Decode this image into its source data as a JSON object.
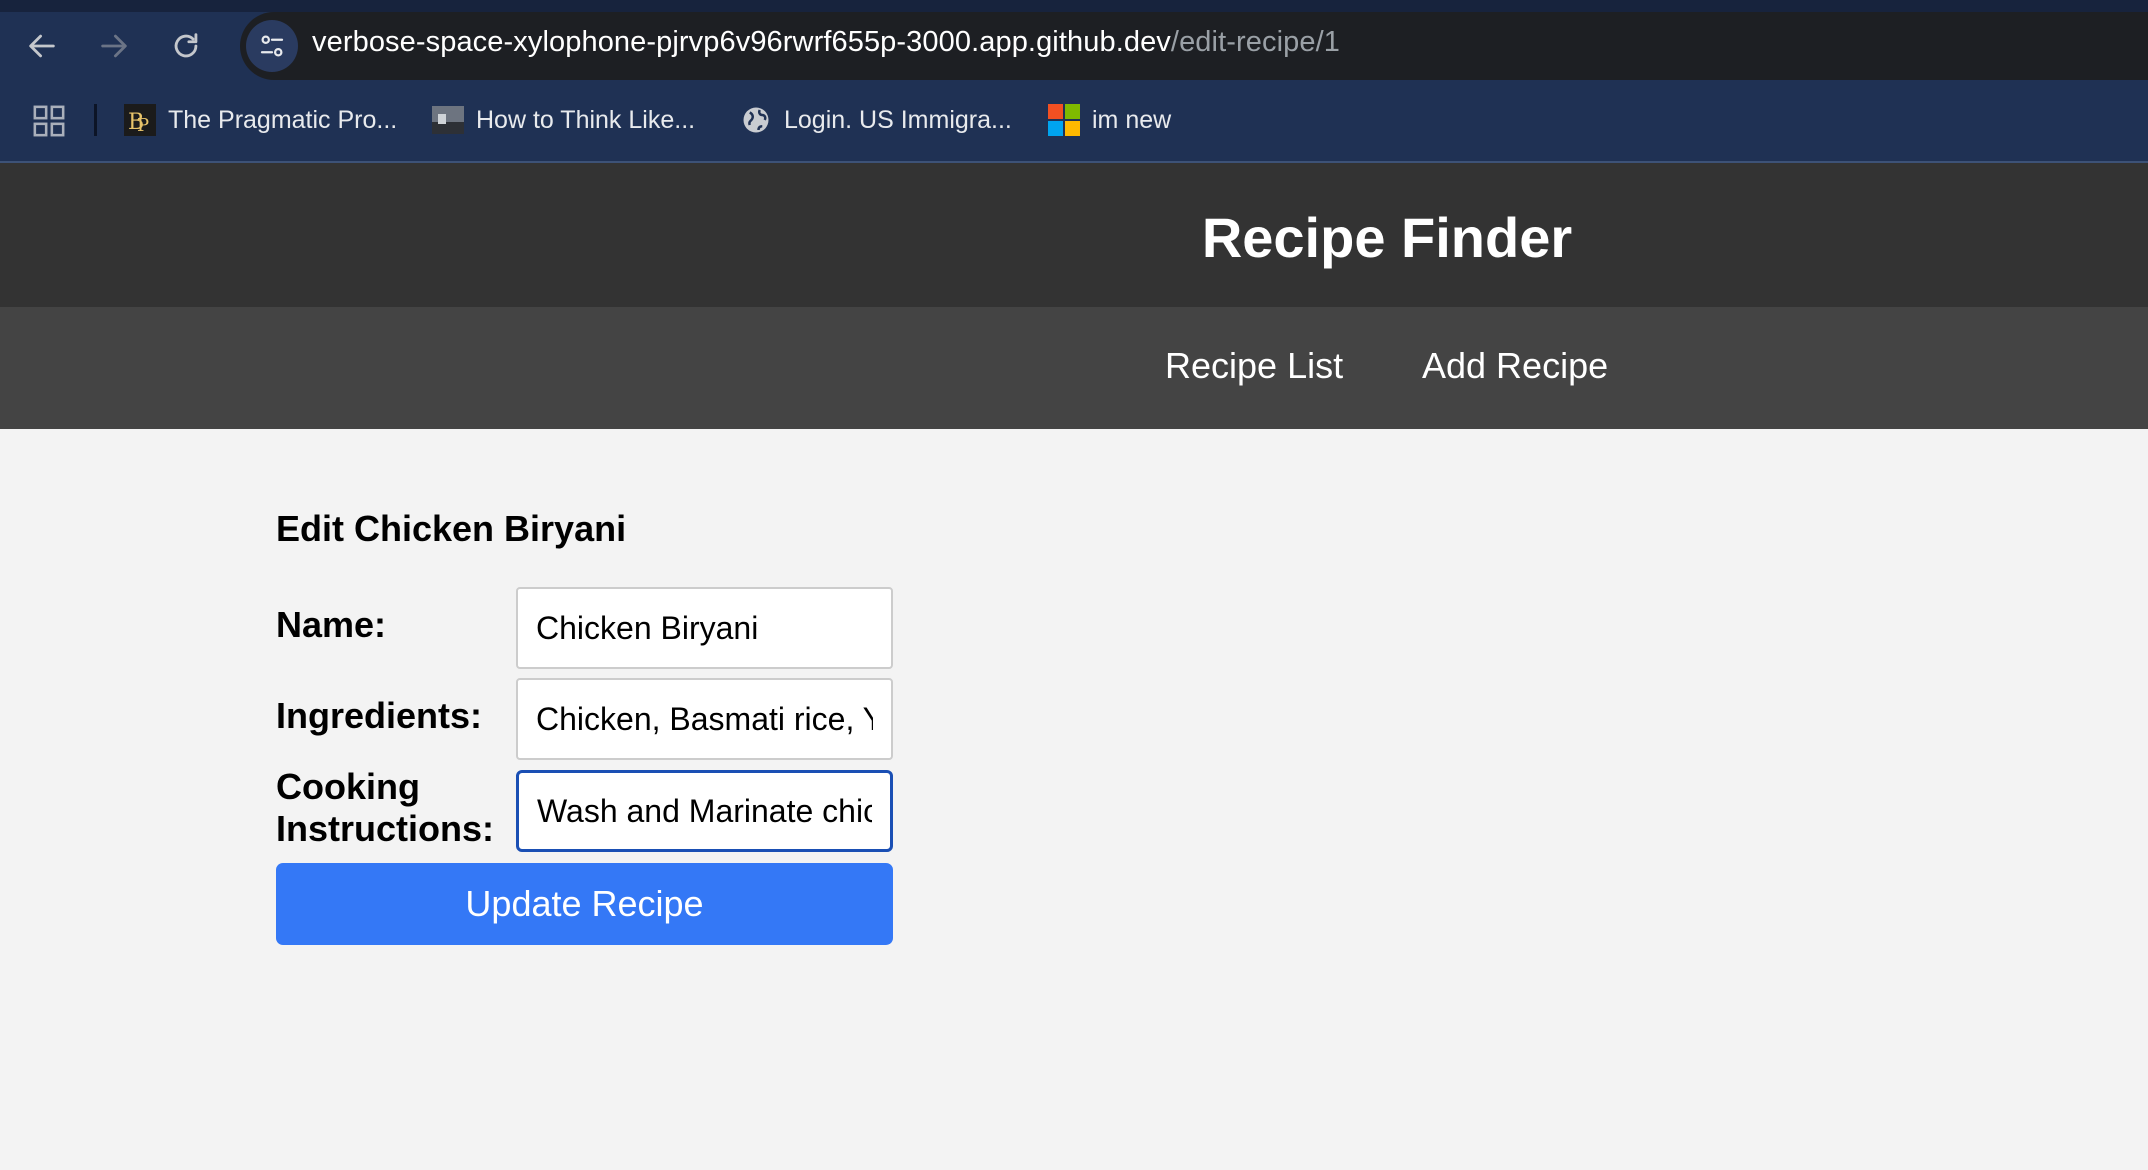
{
  "browser": {
    "url_host": "verbose-space-xylophone-pjrvp6v96rwrf655p-3000.app.github.dev",
    "url_path": "/edit-recipe/1",
    "nav_icons": [
      "back-arrow-icon",
      "forward-arrow-icon",
      "reload-icon"
    ],
    "site_info_icon": "tune-icon",
    "bookmarks": [
      {
        "label": "The Pragmatic Pro...",
        "icon": "pragmatic-bookshelf-icon"
      },
      {
        "label": "How to Think Like...",
        "icon": "thumbnail-icon"
      },
      {
        "label": "Login. US Immigra...",
        "icon": "globe-icon"
      },
      {
        "label": "im new",
        "icon": "microsoft-icon"
      }
    ]
  },
  "app": {
    "title": "Recipe Finder",
    "nav": [
      "Recipe List",
      "Add Recipe"
    ]
  },
  "form": {
    "heading": "Edit Chicken Biryani",
    "name_label": "Name:",
    "name_value": "Chicken Biryani",
    "ingredients_label": "Ingredients:",
    "ingredients_value": "Chicken, Basmati rice, Y",
    "instructions_label_line1": "Cooking",
    "instructions_label_line2": "Instructions:",
    "instructions_value": "Wash and Marinate chic",
    "submit_label": "Update Recipe"
  },
  "colors": {
    "chrome_bg": "#1f3154",
    "header_bg": "#333333",
    "nav_bg": "#444444",
    "button_bg": "#3478f6",
    "focus_border": "#1a4fb4"
  }
}
